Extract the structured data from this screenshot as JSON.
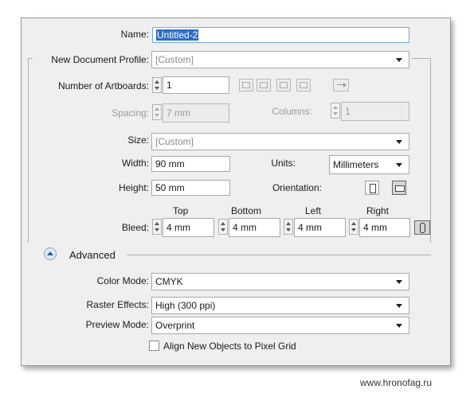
{
  "name": {
    "label": "Name:",
    "value": "Untitled-2"
  },
  "profile": {
    "label": "New Document Profile:",
    "value": "[Custom]"
  },
  "artboards": {
    "label": "Number of Artboards:",
    "value": "1"
  },
  "spacing": {
    "label": "Spacing:",
    "value": "7 mm"
  },
  "columns": {
    "label": "Columns:",
    "value": "1"
  },
  "size": {
    "label": "Size:",
    "value": "[Custom]"
  },
  "width": {
    "label": "Width:",
    "value": "90 mm"
  },
  "units": {
    "label": "Units:",
    "value": "Millimeters"
  },
  "height": {
    "label": "Height:",
    "value": "50 mm"
  },
  "orientation": {
    "label": "Orientation:",
    "selected": "landscape"
  },
  "bleed": {
    "label": "Bleed:",
    "top": {
      "label": "Top",
      "value": "4 mm"
    },
    "bottom": {
      "label": "Bottom",
      "value": "4 mm"
    },
    "left": {
      "label": "Left",
      "value": "4 mm"
    },
    "right": {
      "label": "Right",
      "value": "4 mm"
    }
  },
  "advanced": {
    "label": "Advanced",
    "expanded": true
  },
  "color_mode": {
    "label": "Color Mode:",
    "value": "CMYK"
  },
  "raster_effects": {
    "label": "Raster Effects:",
    "value": "High (300 ppi)"
  },
  "preview_mode": {
    "label": "Preview Mode:",
    "value": "Overprint"
  },
  "align_pixel_grid": {
    "label": "Align New Objects to Pixel Grid",
    "checked": false
  },
  "watermark": "www.hronofag.ru"
}
